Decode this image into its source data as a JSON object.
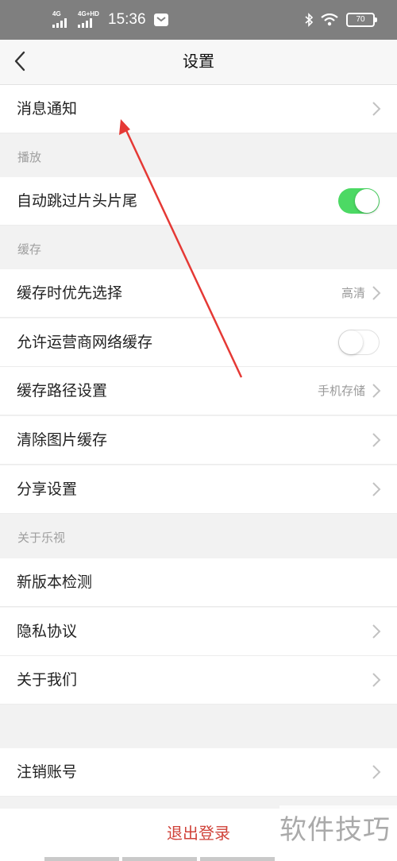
{
  "status_bar": {
    "net1": "4G",
    "net2": "4G+HD",
    "time": "15:36",
    "battery": "70"
  },
  "header": {
    "title": "设置"
  },
  "rows": {
    "notifications": "消息通知",
    "auto_skip": "自动跳过片头片尾",
    "cache_quality": "缓存时优先选择",
    "cache_quality_value": "高清",
    "carrier_cache": "允许运营商网络缓存",
    "cache_path": "缓存路径设置",
    "cache_path_value": "手机存储",
    "clear_image_cache": "清除图片缓存",
    "share_settings": "分享设置",
    "check_update": "新版本检测",
    "privacy": "隐私协议",
    "about_us": "关于我们",
    "deactivate": "注销账号",
    "logout": "退出登录"
  },
  "sections": {
    "playback": "播放",
    "cache": "缓存",
    "about": "关于乐视"
  },
  "toggles": {
    "auto_skip": true,
    "carrier_cache": false
  },
  "watermark": "软件技巧",
  "colors": {
    "accent_green": "#4cd964",
    "logout_red": "#d0433a",
    "annotation_red": "#e53935"
  }
}
